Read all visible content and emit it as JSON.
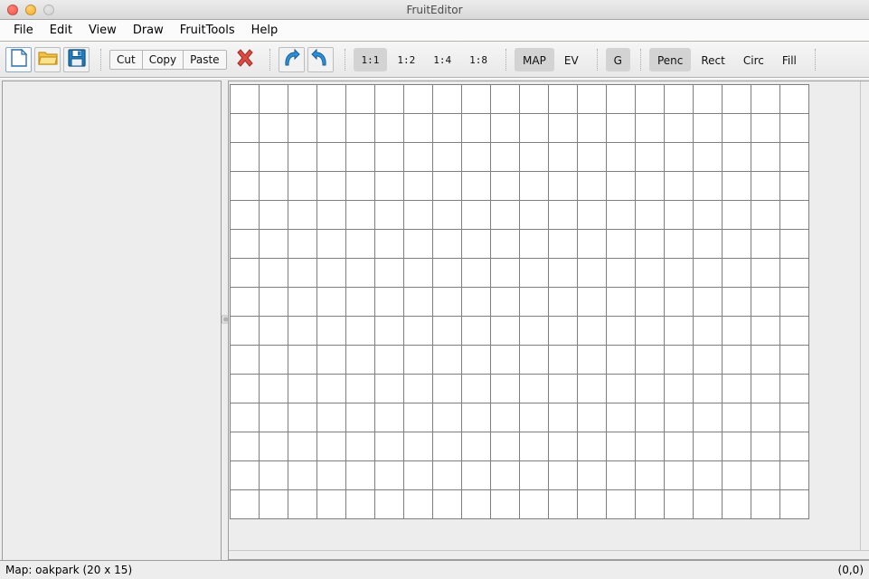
{
  "window": {
    "title": "FruitEditor",
    "controls": {
      "close": "close",
      "minimize": "minimize",
      "zoom": "zoom"
    }
  },
  "menubar": {
    "items": [
      {
        "label": "File"
      },
      {
        "label": "Edit"
      },
      {
        "label": "View"
      },
      {
        "label": "Draw"
      },
      {
        "label": "FruitTools"
      },
      {
        "label": "Help"
      }
    ]
  },
  "toolbar": {
    "file_group": [
      {
        "name": "new-file-icon",
        "label": ""
      },
      {
        "name": "open-folder-icon",
        "label": ""
      },
      {
        "name": "save-disk-icon",
        "label": ""
      }
    ],
    "clipboard_group": [
      {
        "label": "Cut"
      },
      {
        "label": "Copy"
      },
      {
        "label": "Paste"
      }
    ],
    "delete_label": "",
    "history_group": [
      {
        "name": "undo-icon",
        "label": ""
      },
      {
        "name": "redo-icon",
        "label": ""
      }
    ],
    "zoom_group": [
      {
        "label": "1:1",
        "active": true
      },
      {
        "label": "1:2",
        "active": false
      },
      {
        "label": "1:4",
        "active": false
      },
      {
        "label": "1:8",
        "active": false
      }
    ],
    "layer_group": [
      {
        "label": "MAP",
        "active": true
      },
      {
        "label": "EV",
        "active": false
      }
    ],
    "grid_group": [
      {
        "label": "G",
        "active": true
      }
    ],
    "tool_group": [
      {
        "label": "Penc",
        "active": true
      },
      {
        "label": "Rect",
        "active": false
      },
      {
        "label": "Circ",
        "active": false
      },
      {
        "label": "Fill",
        "active": false
      }
    ]
  },
  "map": {
    "columns": 20,
    "rows": 15,
    "cell_size": 32,
    "background_color": "#ffffff",
    "grid_line_color": "#7f7f7f"
  },
  "statusbar": {
    "map_info": "Map: oakpark (20 x 15)",
    "cursor": "(0,0)"
  }
}
